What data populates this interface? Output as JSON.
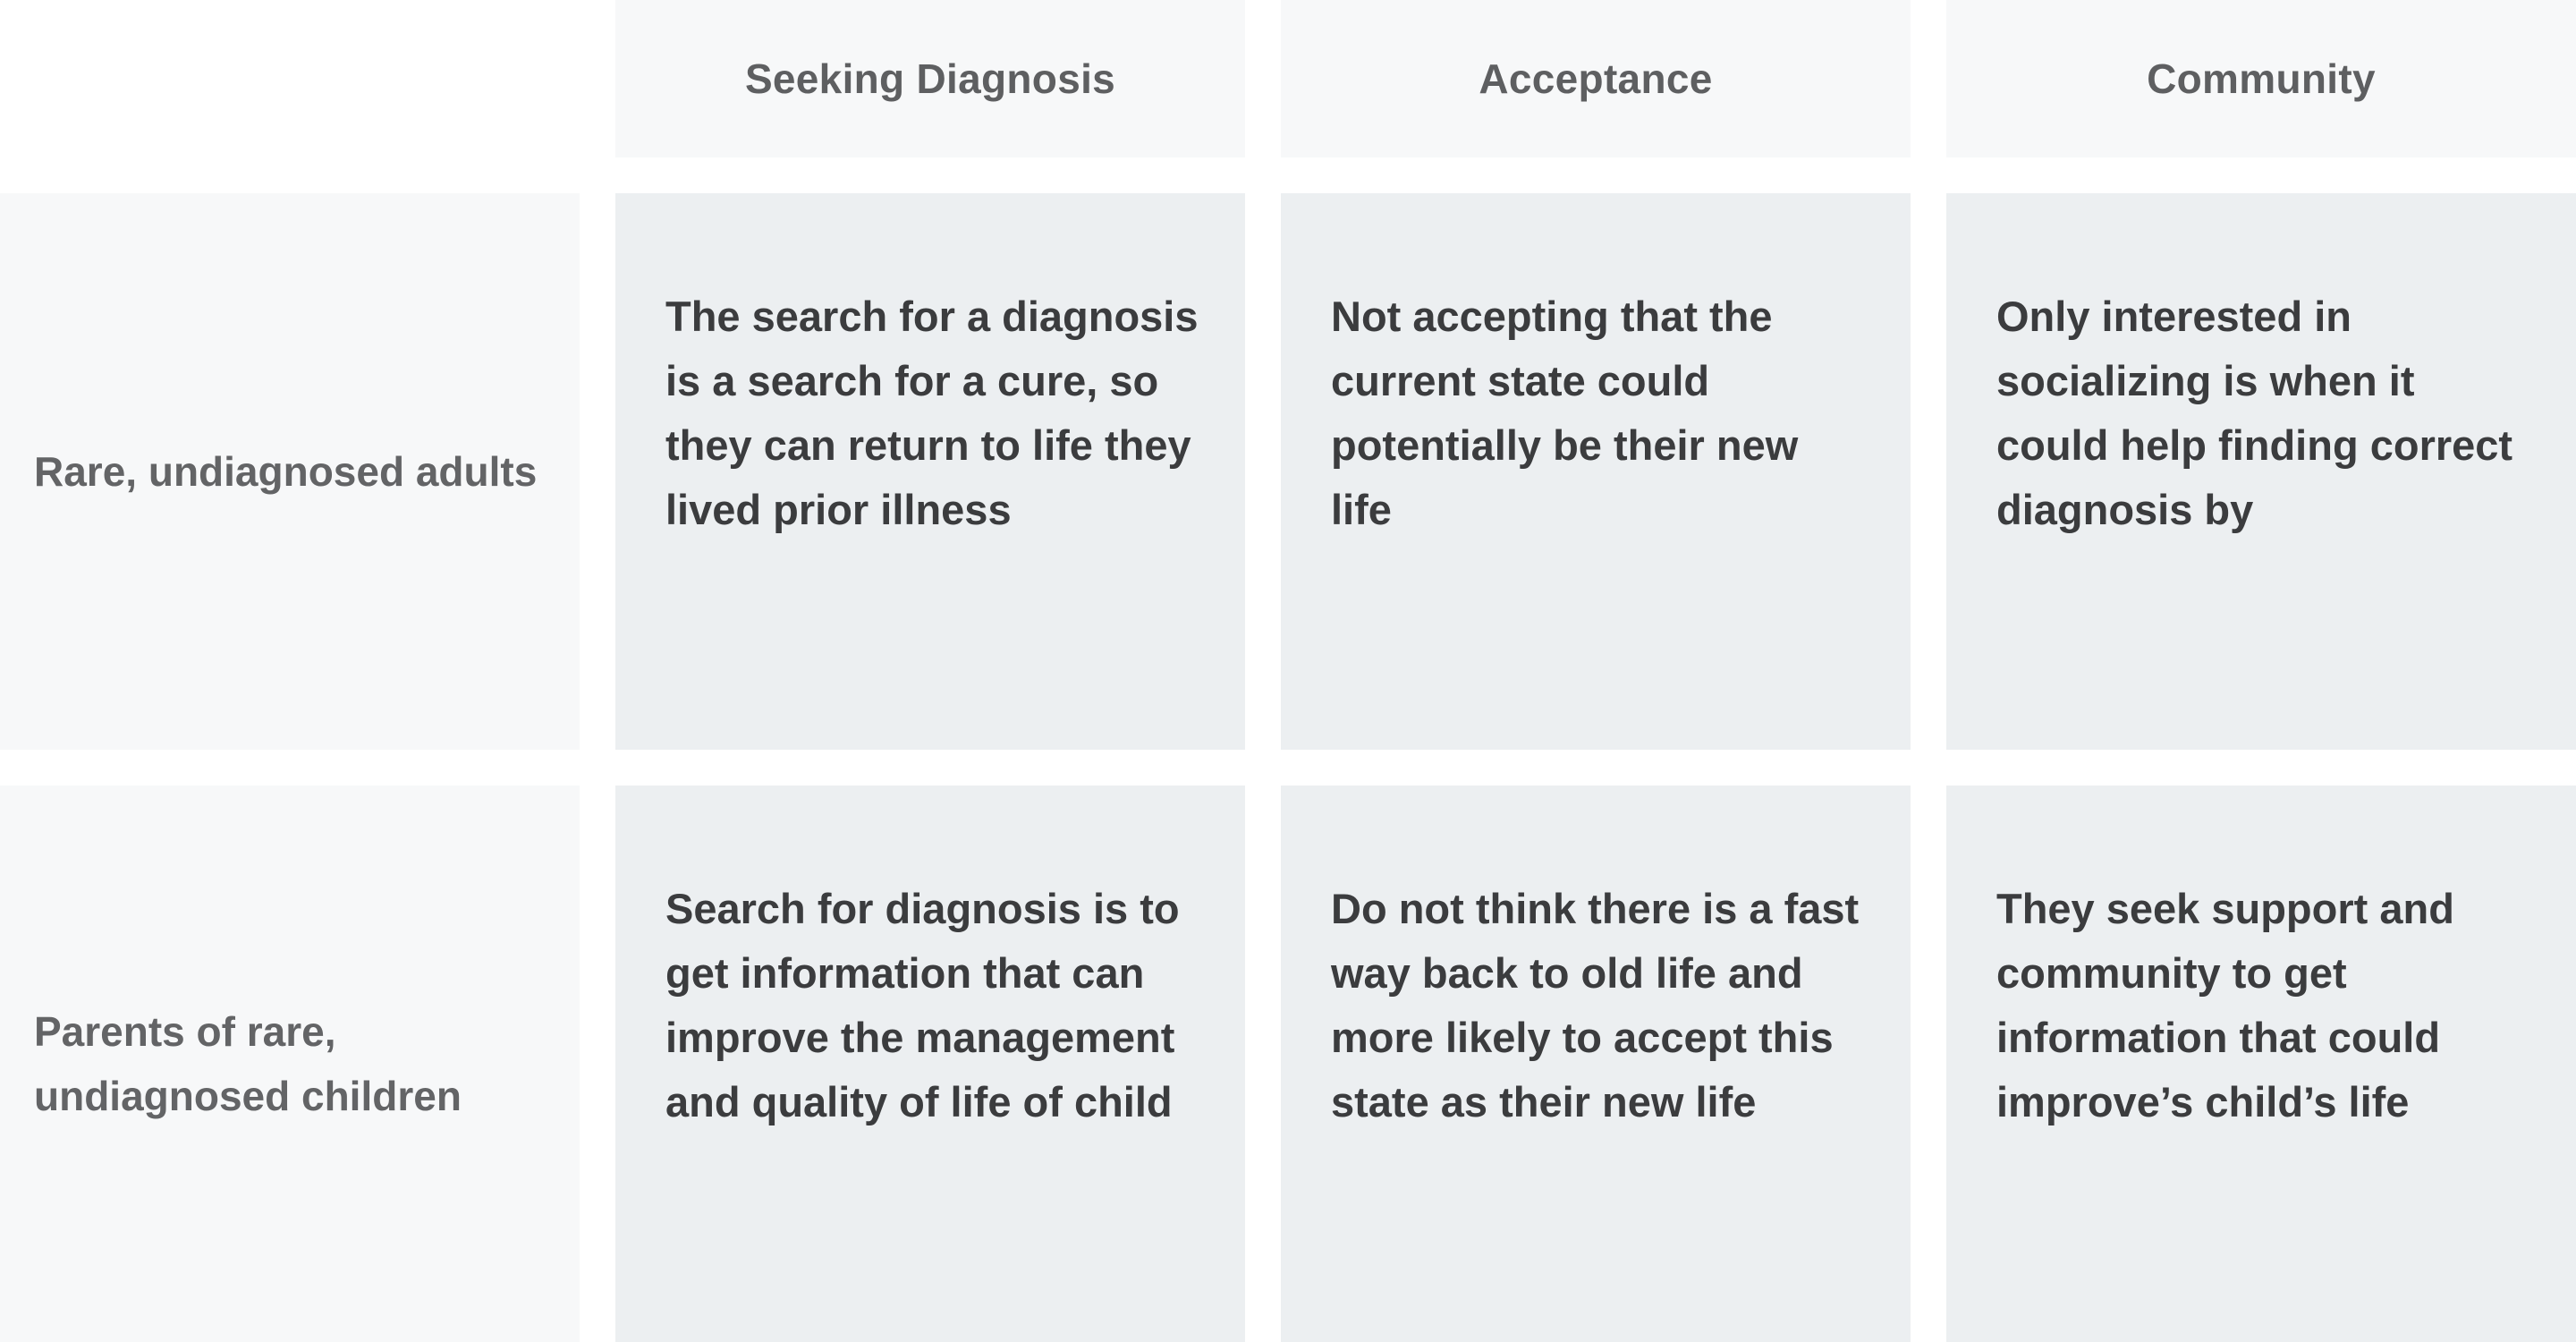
{
  "columns": [
    {
      "label": "Seeking Diagnosis"
    },
    {
      "label": "Acceptance"
    },
    {
      "label": "Community"
    }
  ],
  "rows": [
    {
      "label": "Rare, undiagnosed adults",
      "cells": [
        "The search for a diagnosis is a search for a cure, so they can return to life they lived prior illness",
        "Not accepting that the current state could potentially be their new life",
        "Only interested in socializing is when it could help finding correct diagnosis by"
      ]
    },
    {
      "label": "Parents of rare, undiagnosed children",
      "cells": [
        "Search for diagnosis is to get information that can improve the management and quality of life of child",
        "Do not think there is a fast way back to old life and more likely to accept this state as their new life",
        "They seek support and community to get information that could improve’s child’s life"
      ]
    }
  ]
}
